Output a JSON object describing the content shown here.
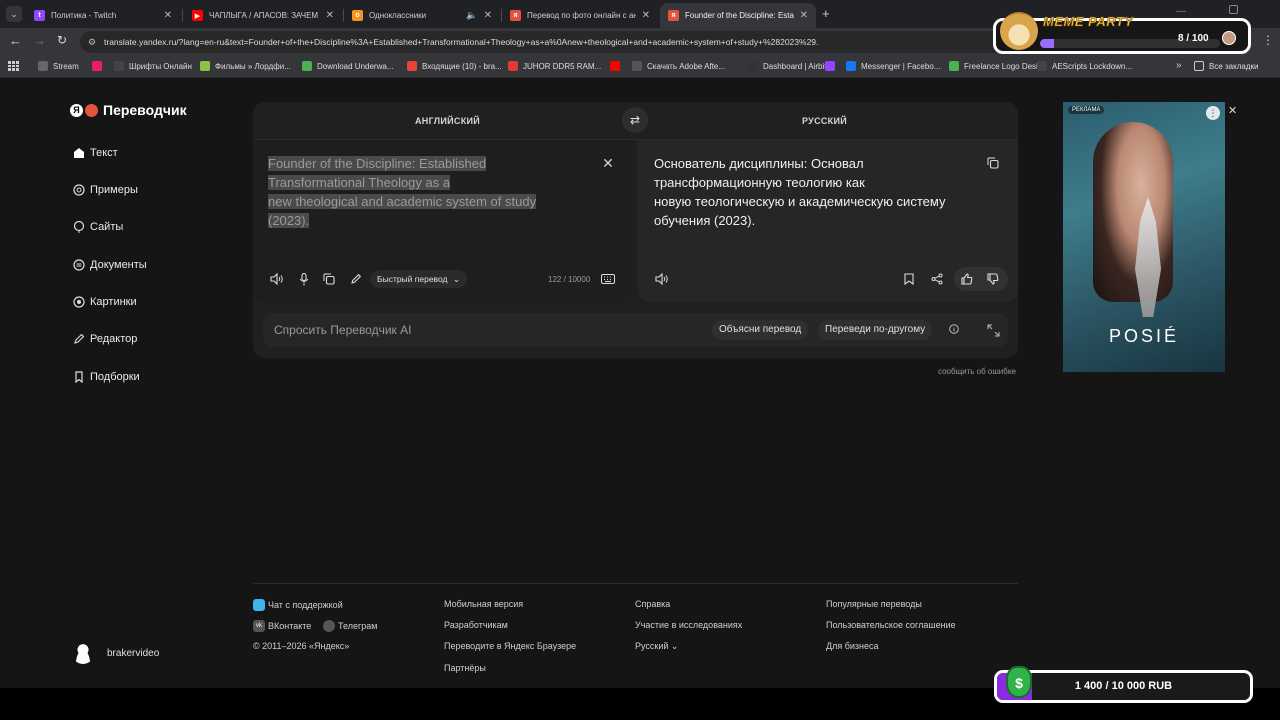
{
  "tabs": [
    {
      "title": "Политика - Twitch",
      "color": "#9146ff",
      "glyph": "t"
    },
    {
      "title": "ЧАПЛЫГА / АПАСОВ: ЗАЧЕМ П",
      "color": "#ff0000",
      "glyph": "▶"
    },
    {
      "title": "Одноклассники",
      "color": "#f7931e",
      "glyph": "o"
    },
    {
      "title": "Перевод по фото онлайн с ан",
      "color": "#e5533d",
      "glyph": "я"
    },
    {
      "title": "Founder of the Discipline: Estab",
      "color": "#e5533d",
      "glyph": "я"
    }
  ],
  "url": "translate.yandex.ru/?lang=en-ru&text=Founder+of+the+Discipline%3A+Established+Transformational+Theology+as+a%0Anew+theological+and+academic+system+of+study+%282023%29.",
  "bookmarks": [
    {
      "label": "Stream",
      "color": "#666"
    },
    {
      "label": "",
      "color": "#e91e63"
    },
    {
      "label": "Шрифты Онлайн",
      "color": "#444"
    },
    {
      "label": "Фильмы » Лордфи...",
      "color": "#8bc34a"
    },
    {
      "label": "Download Underwa...",
      "color": "#4caf50"
    },
    {
      "label": "Входящие (10) - bra...",
      "color": "#ea4335"
    },
    {
      "label": "JUHOR DDR5 RAM...",
      "color": "#e53935"
    },
    {
      "label": "",
      "color": "#ff0000"
    },
    {
      "label": "Скачать Adobe Afte...",
      "color": "#555"
    },
    {
      "label": "Dashboard | Airbit",
      "color": "#333"
    },
    {
      "label": "",
      "color": "#9146ff"
    },
    {
      "label": "Messenger | Facebo...",
      "color": "#1877f2"
    },
    {
      "label": "Freelance Logo Desi...",
      "color": "#4caf50"
    },
    {
      "label": "AEScripts Lockdown...",
      "color": "#444"
    }
  ],
  "all_bookmarks": "Все закладки",
  "brand": "Переводчик",
  "sidebar": [
    {
      "label": "Текст",
      "icon": "home-icon"
    },
    {
      "label": "Примеры",
      "icon": "examples-icon"
    },
    {
      "label": "Сайты",
      "icon": "sites-icon"
    },
    {
      "label": "Документы",
      "icon": "documents-icon"
    },
    {
      "label": "Картинки",
      "icon": "images-icon"
    },
    {
      "label": "Редактор",
      "icon": "editor-icon"
    },
    {
      "label": "Подборки",
      "icon": "collections-icon"
    }
  ],
  "source_lang": "АНГЛИЙСКИЙ",
  "target_lang": "РУССКИЙ",
  "source_lines": [
    "Founder of the Discipline: Established ",
    "Transformational Theology as a ",
    "new theological and academic system of study ",
    "(2023)."
  ],
  "target_lines": [
    "Основатель дисциплины: Основал",
    "трансформационную теологию как",
    "новую теологическую и академическую систему",
    "обучения (2023)."
  ],
  "mode_label": "Быстрый перевод",
  "char_count": "122 / 10000",
  "ask_placeholder": "Спросить Переводчик AI",
  "chip_explain": "Объясни перевод",
  "chip_other": "Переведи по-другому",
  "report": "сообщить об ошибке",
  "ad": {
    "label": "РЕКЛАМА",
    "brand": "POSIÉ"
  },
  "meme": {
    "title": "MEME PARTY",
    "count": "8 / 100"
  },
  "donate": {
    "amount": "1 400 / 10 000 RUB",
    "progress": 0.14
  },
  "footer": {
    "col1": [
      "Чат с поддержкой",
      "ВКонтакте",
      "Телеграм",
      "© 2011–2026 «Яндекс»"
    ],
    "col2": [
      "Мобильная версия",
      "Разработчикам",
      "Переводите в Яндекс Браузере",
      "Партнёры"
    ],
    "col3": [
      "Справка",
      "Участие в исследованиях",
      "Русский"
    ],
    "col4": [
      "Популярные переводы",
      "Пользовательское соглашение",
      "Для бизнеса"
    ]
  },
  "user": "brakervideo"
}
